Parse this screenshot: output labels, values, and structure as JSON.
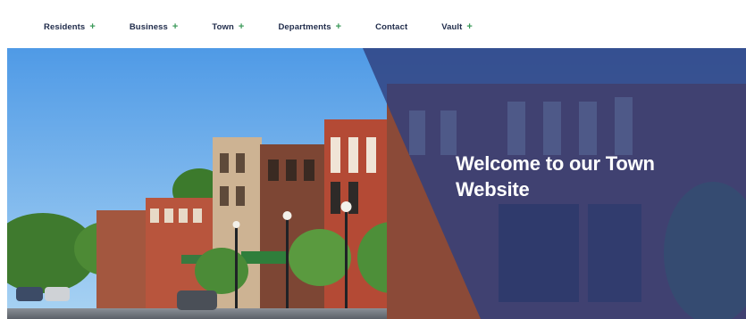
{
  "nav": {
    "items": [
      {
        "label": "Residents",
        "has_submenu": true
      },
      {
        "label": "Business",
        "has_submenu": true
      },
      {
        "label": "Town",
        "has_submenu": true
      },
      {
        "label": "Departments",
        "has_submenu": true
      },
      {
        "label": "Contact",
        "has_submenu": false
      },
      {
        "label": "Vault",
        "has_submenu": true
      }
    ],
    "submenu_glyph": "+"
  },
  "hero": {
    "title": "Welcome to our Town Website",
    "overlay_color": "#2f3f7e",
    "image": "small-town-main-street-photo"
  },
  "colors": {
    "nav_text": "#1f2b4a",
    "accent": "#3c9a5a"
  }
}
